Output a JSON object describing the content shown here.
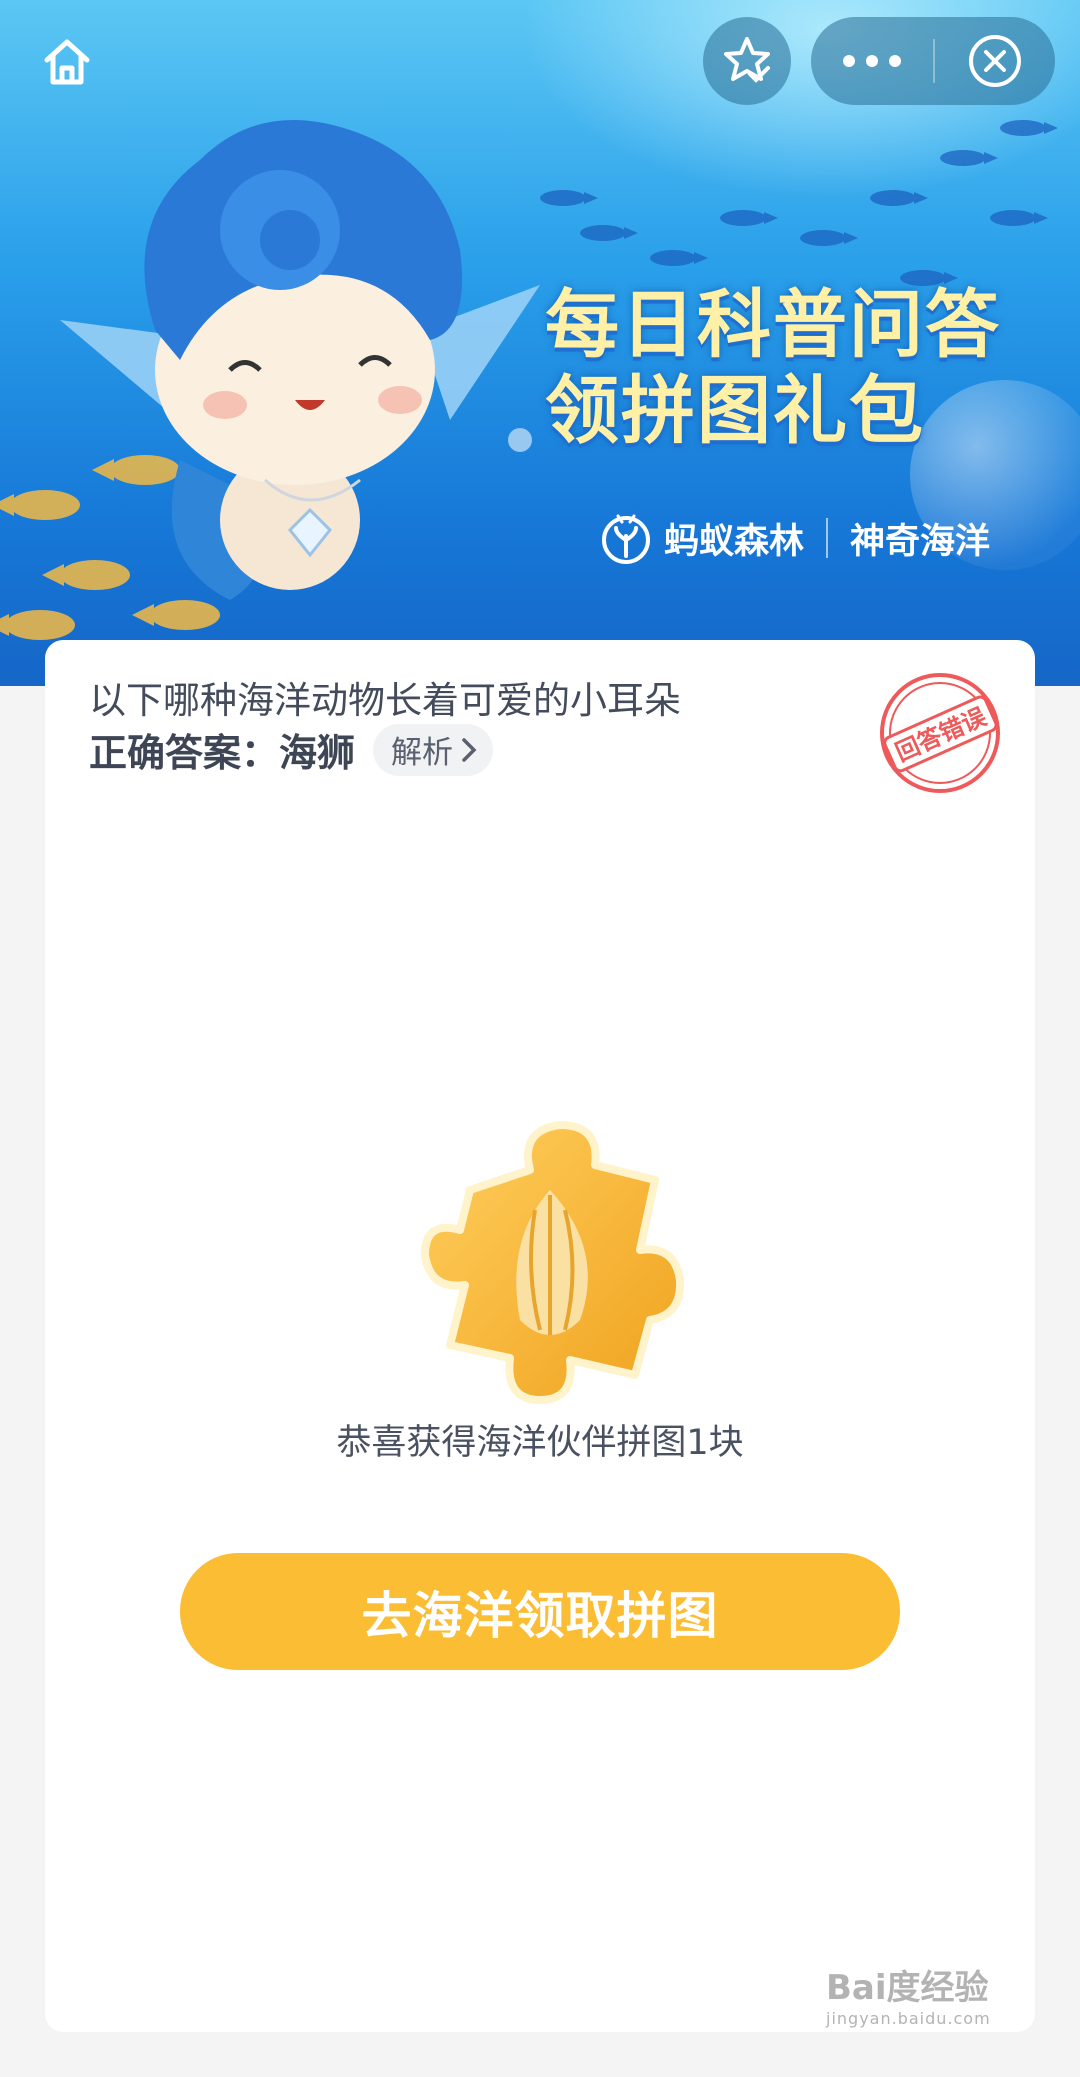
{
  "banner": {
    "title_line1": "每日科普问答",
    "title_line2": "领拼图礼包",
    "brand_name": "蚂蚁森林",
    "brand_partner": "神奇海洋"
  },
  "topbar": {
    "home_icon": "home-icon",
    "favorite_icon": "star-check-icon",
    "more_icon": "more-dots-icon",
    "close_icon": "close-circle-icon"
  },
  "quiz": {
    "question": "以下哪种海洋动物长着可爱的小耳朵",
    "answer_label": "正确答案：",
    "answer_value": "海狮",
    "analysis_label": "解析",
    "stamp_text": "回答错误"
  },
  "reward": {
    "text": "恭喜获得海洋伙伴拼图1块",
    "button_label": "去海洋领取拼图"
  },
  "watermark": {
    "text": "Bai度经验",
    "url": "jingyan.baidu.com"
  },
  "colors": {
    "cta": "#fbbd33",
    "stamp": "#ee5a5a",
    "banner_top": "#5cc7f4",
    "banner_bottom": "#1566c7"
  }
}
